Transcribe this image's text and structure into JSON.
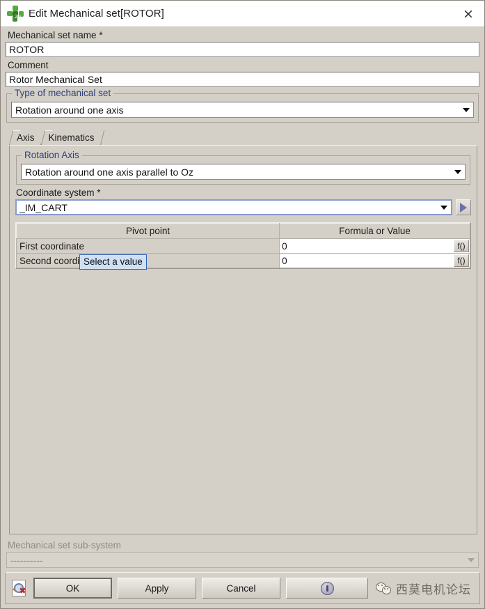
{
  "window": {
    "title": "Edit Mechanical set[ROTOR]",
    "icon": "flux-2d-pinwheel-icon",
    "close_label": "×"
  },
  "form": {
    "name_label": "Mechanical set name *",
    "name_value": "ROTOR",
    "comment_label": "Comment",
    "comment_value": "Rotor Mechanical Set"
  },
  "type_group": {
    "title": "Type of mechanical set",
    "selected": "Rotation around one axis"
  },
  "tabs": [
    {
      "label": "Axis",
      "selected": true
    },
    {
      "label": "Kinematics",
      "selected": false
    }
  ],
  "axis_tab": {
    "rotation_group": {
      "title": "Rotation Axis",
      "selected": "Rotation around one axis parallel to Oz"
    },
    "coordinate_system": {
      "label": "Coordinate system *",
      "value": "_IM_CART",
      "expand_button": "coordinate-system-expand"
    },
    "table": {
      "headers": [
        "Pivot point",
        "Formula or Value"
      ],
      "rows": [
        {
          "name": "First coordinate",
          "value": "0",
          "formula_button": "f()"
        },
        {
          "name": "Second coordinate",
          "value": "0",
          "formula_button": "f()"
        }
      ]
    }
  },
  "tooltip": {
    "text": "Select a value"
  },
  "subsystem": {
    "label": "Mechanical set sub-system",
    "value": "----------"
  },
  "buttons": {
    "preview": "preview-icon",
    "ok": "OK",
    "apply": "Apply",
    "cancel": "Cancel",
    "help": "help-icon"
  },
  "watermark": {
    "text": "西莫电机论坛",
    "icon": "wechat-icon"
  },
  "colors": {
    "window_bg": "#d4d0c8",
    "field_bg": "#ffffff",
    "group_title": "#2f3f7a",
    "tooltip_bg": "#cfe0f5",
    "tooltip_border": "#2f62b4",
    "accent_arrow": "#6f6fa8",
    "icon_green": "#55ab3f"
  }
}
